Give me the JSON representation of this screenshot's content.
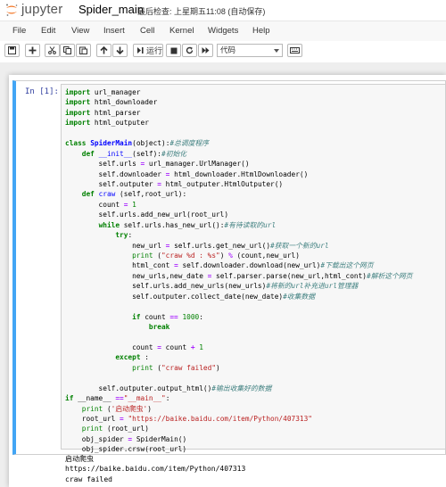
{
  "header": {
    "logo_text": "jupyter",
    "notebook_name": "Spider_main",
    "checkpoint_label": "最后检查: 上星期五11:08",
    "autosave_label": "(自动保存)"
  },
  "menubar": {
    "items": [
      "File",
      "Edit",
      "View",
      "Insert",
      "Cell",
      "Kernel",
      "Widgets",
      "Help"
    ]
  },
  "toolbar": {
    "run_label": "运行",
    "celltype_value": "代码",
    "icons": [
      "save-icon",
      "add-cell-icon",
      "cut-icon",
      "copy-icon",
      "paste-icon",
      "move-up-icon",
      "move-down-icon",
      "run-icon",
      "stop-icon",
      "restart-icon",
      "fast-forward-icon",
      "keyboard-icon"
    ]
  },
  "cell": {
    "prompt": "In  [1]:",
    "code_lines": [
      "import url_manager",
      "import html_downloader",
      "import html_parser",
      "import html_outputer",
      "",
      "class SpiderMain(object):#总调度程序",
      "    def __init__(self):#初始化",
      "        self.urls = url_manager.UrlManager()",
      "        self.downloader = html_downloader.HtmlDownloader()",
      "        self.outputer = html_outputer.HtmlOutputer()",
      "    def craw (self,root_url):",
      "        count = 1",
      "        self.urls.add_new_url(root_url)",
      "        while self.urls.has_new_url():#有待读取的url",
      "            try:",
      "                new_url = self.urls.get_new_url()#获取一个新的url",
      "                print (\"craw %d : %s\") % (count,new_url)",
      "                html_cont = self.downloader.download(new_url)#下载出这个网页",
      "                new_urls,new_date = self.parser.parse(new_url,html_cont)#解析这个网页",
      "                self.urls.add_new_urls(new_urls)#将新的url补充进url管理器",
      "                self.outputer.collect_date(new_date)#收集数据",
      "",
      "                if count == 1000:",
      "                    break",
      "",
      "                count = count + 1",
      "            except :",
      "                print (\"craw failed\")",
      "",
      "        self.outputer.output_html()#输出收集好的数据",
      "if __name__ ==\"__main__\":",
      "    print ('启动爬虫')",
      "    root_url = \"https://baike.baidu.com/item/Python/407313\"",
      "    print (root_url)",
      "    obj_spider = SpiderMain()",
      "    obj_spider.crsw(root_url)"
    ]
  },
  "output": {
    "lines": [
      "启动爬虫",
      "https://baike.baidu.com/item/Python/407313",
      "craw failed"
    ]
  }
}
